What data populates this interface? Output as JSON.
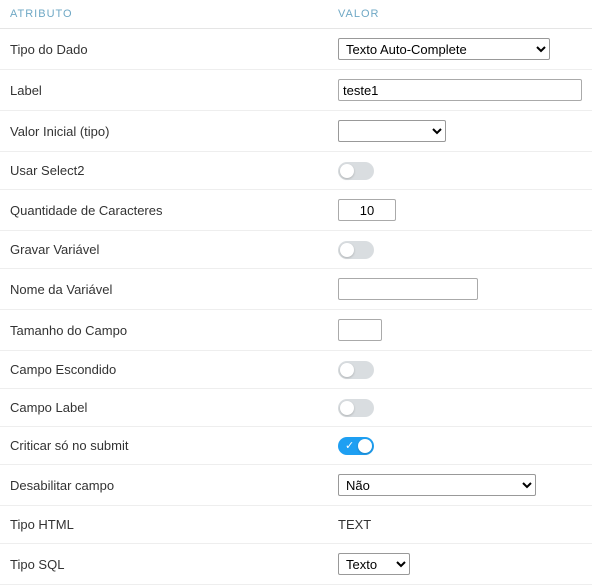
{
  "headers": {
    "attr": "ATRIBUTO",
    "val": "VALOR"
  },
  "rows": {
    "tipo_dado": {
      "label": "Tipo do Dado",
      "value": "Texto Auto-Complete"
    },
    "label": {
      "label": "Label",
      "value": "teste1"
    },
    "valor_inicial": {
      "label": "Valor Inicial (tipo)",
      "value": ""
    },
    "usar_select2": {
      "label": "Usar Select2"
    },
    "qtd_caracteres": {
      "label": "Quantidade de Caracteres",
      "value": "10"
    },
    "gravar_variavel": {
      "label": "Gravar Variável"
    },
    "nome_variavel": {
      "label": "Nome da Variável",
      "value": ""
    },
    "tamanho_campo": {
      "label": "Tamanho do Campo",
      "value": ""
    },
    "campo_escondido": {
      "label": "Campo Escondido"
    },
    "campo_label": {
      "label": "Campo Label"
    },
    "criticar_submit": {
      "label": "Criticar só no submit"
    },
    "desabilitar": {
      "label": "Desabilitar campo",
      "value": "Não"
    },
    "tipo_html": {
      "label": "Tipo HTML",
      "value": "TEXT"
    },
    "tipo_sql": {
      "label": "Tipo SQL",
      "value": "Texto"
    }
  }
}
